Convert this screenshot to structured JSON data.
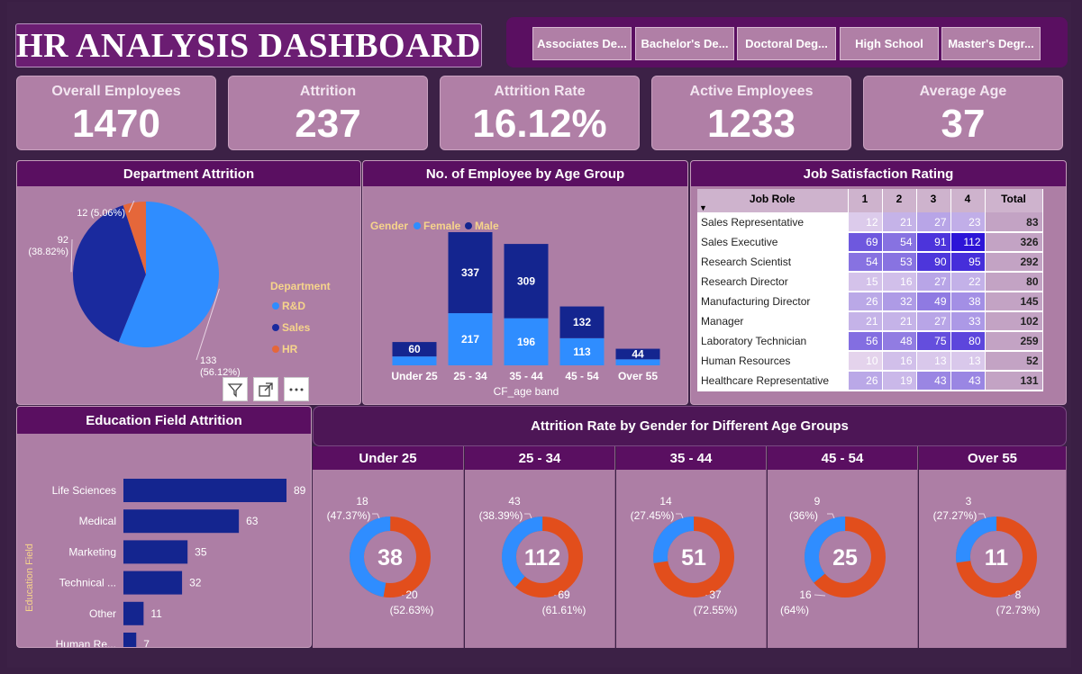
{
  "title": "HR ANALYSIS DASHBOARD",
  "education_slicer": [
    "Associates De...",
    "Bachelor's De...",
    "Doctoral Deg...",
    "High School",
    "Master's Degr..."
  ],
  "kpis": [
    {
      "label": "Overall Employees",
      "value": "1470"
    },
    {
      "label": "Attrition",
      "value": "237"
    },
    {
      "label": "Attrition Rate",
      "value": "16.12%"
    },
    {
      "label": "Active Employees",
      "value": "1233"
    },
    {
      "label": "Average Age",
      "value": "37"
    }
  ],
  "visual_icons": [
    "filter-icon",
    "focus-mode-icon",
    "more-options-icon"
  ],
  "colors": {
    "rd": "#2f8dff",
    "sales": "#1a2a9e",
    "hr": "#e5673a",
    "female": "#2f8dff",
    "male": "#14258f",
    "attrition": "#e24e1c",
    "legend_text": "#f6d48b"
  },
  "department_attrition": {
    "title": "Department Attrition",
    "legend_title": "Department",
    "chart_data": {
      "type": "pie",
      "slices": [
        {
          "name": "R&D",
          "value": 133,
          "pct": "(56.12%)"
        },
        {
          "name": "Sales",
          "value": 92,
          "pct": "(38.82%)"
        },
        {
          "name": "HR",
          "value": 12,
          "pct": "(5.06%)"
        }
      ]
    }
  },
  "age_group": {
    "title": "No. of Employee by Age Group",
    "legend_title": "Gender",
    "xlabel": "CF_age band",
    "chart_data": {
      "type": "bar",
      "stacked": true,
      "categories": [
        "Under 25",
        "25 - 34",
        "35 - 44",
        "45 - 54",
        "Over 55"
      ],
      "series": [
        {
          "name": "Female",
          "values": [
            37,
            217,
            196,
            113,
            25
          ]
        },
        {
          "name": "Male",
          "values": [
            60,
            337,
            309,
            132,
            44
          ]
        }
      ],
      "data_labels": [
        {
          "female": "",
          "male": "60"
        },
        {
          "female": "217",
          "male": "337"
        },
        {
          "female": "196",
          "male": "309"
        },
        {
          "female": "113",
          "male": "132"
        },
        {
          "female": "",
          "male": "44"
        }
      ]
    }
  },
  "job_satisfaction": {
    "title": "Job Satisfaction Rating",
    "columns": [
      "Job Role",
      "1",
      "2",
      "3",
      "4",
      "Total"
    ],
    "rows": [
      [
        "Sales Representative",
        12,
        21,
        27,
        23,
        83
      ],
      [
        "Sales Executive",
        69,
        54,
        91,
        112,
        326
      ],
      [
        "Research Scientist",
        54,
        53,
        90,
        95,
        292
      ],
      [
        "Research Director",
        15,
        16,
        27,
        22,
        80
      ],
      [
        "Manufacturing Director",
        26,
        32,
        49,
        38,
        145
      ],
      [
        "Manager",
        21,
        21,
        27,
        33,
        102
      ],
      [
        "Laboratory Technician",
        56,
        48,
        75,
        80,
        259
      ],
      [
        "Human Resources",
        10,
        16,
        13,
        13,
        52
      ],
      [
        "Healthcare Representative",
        26,
        19,
        43,
        43,
        131
      ]
    ]
  },
  "education_field": {
    "title": "Education Field Attrition",
    "ylabel": "Education Field",
    "chart_data": {
      "type": "bar",
      "orientation": "horizontal",
      "categories": [
        "Life Sciences",
        "Medical",
        "Marketing",
        "Technical ...",
        "Other",
        "Human Re..."
      ],
      "values": [
        89,
        63,
        35,
        32,
        11,
        7
      ]
    }
  },
  "gender_attrition": {
    "title": "Attrition Rate by Gender for Different Age Groups",
    "chart_data": [
      {
        "type": "donut",
        "group": "Under 25",
        "total": "38",
        "female": 18,
        "female_pct": "(47.37%)",
        "male": 20,
        "male_pct": "(52.63%)"
      },
      {
        "type": "donut",
        "group": "25 - 34",
        "total": "112",
        "female": 43,
        "female_pct": "(38.39%)",
        "male": 69,
        "male_pct": "(61.61%)"
      },
      {
        "type": "donut",
        "group": "35 - 44",
        "total": "51",
        "female": 14,
        "female_pct": "(27.45%)",
        "male": 37,
        "male_pct": "(72.55%)"
      },
      {
        "type": "donut",
        "group": "45 - 54",
        "total": "25",
        "female": 9,
        "female_pct": "(36%)",
        "male": 16,
        "male_pct": "(64%)"
      },
      {
        "type": "donut",
        "group": "Over 55",
        "total": "11",
        "female": 3,
        "female_pct": "(27.27%)",
        "male": 8,
        "male_pct": "(72.73%)"
      }
    ]
  }
}
